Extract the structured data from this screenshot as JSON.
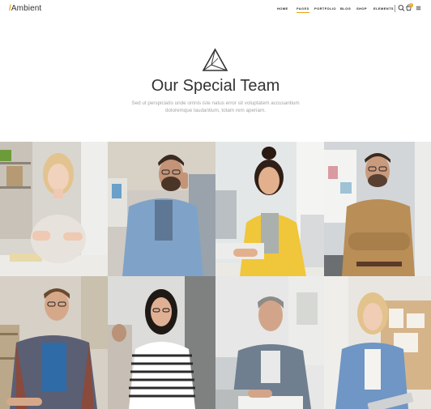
{
  "header": {
    "logo_text": "Ambient",
    "nav": [
      {
        "label": "HOME",
        "active": false
      },
      {
        "label": "PAGES",
        "active": true
      },
      {
        "label": "PORTFOLIO",
        "active": false
      },
      {
        "label": "BLOG",
        "active": false
      },
      {
        "label": "SHOP",
        "active": false
      },
      {
        "label": "ELEMENTS",
        "active": false
      }
    ],
    "cart_count": "0",
    "accent_color": "#e6a614"
  },
  "hero": {
    "title": "Our Special Team",
    "subtitle": "Sed ut perspiciatis unde omnis iste natus error sit voluptatem accusantium doloremque laudantium, totam rem aperiam."
  },
  "team": [
    {
      "name": "team-member-1"
    },
    {
      "name": "team-member-2"
    },
    {
      "name": "team-member-3"
    },
    {
      "name": "team-member-4"
    },
    {
      "name": "team-member-5"
    },
    {
      "name": "team-member-6"
    },
    {
      "name": "team-member-7"
    },
    {
      "name": "team-member-8"
    }
  ]
}
